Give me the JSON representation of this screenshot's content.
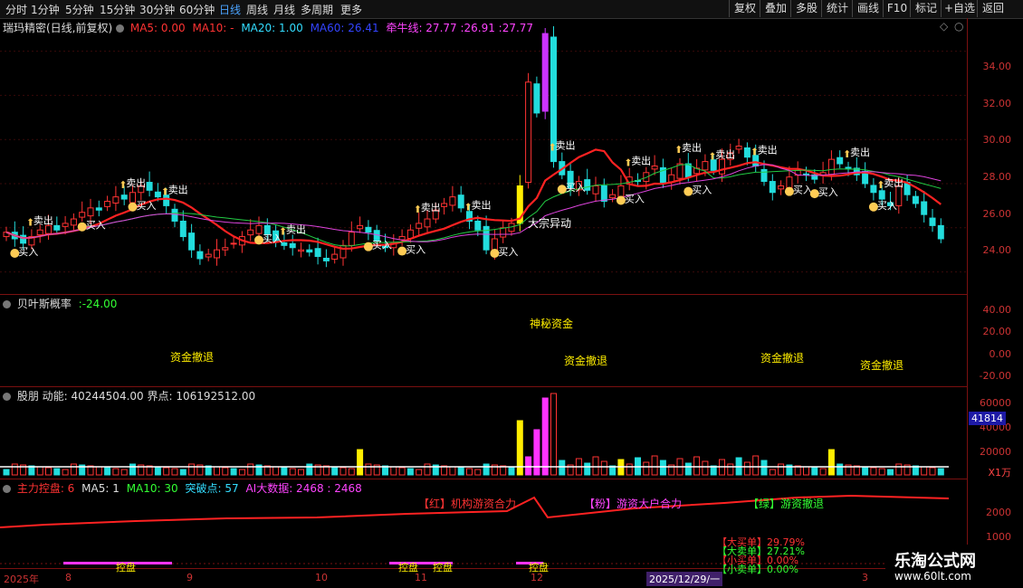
{
  "toolbar": {
    "periods": [
      "分时",
      "1分钟",
      "5分钟",
      "15分钟",
      "30分钟",
      "60分钟",
      "日线",
      "周线",
      "月线",
      "多周期",
      "更多"
    ],
    "active_period": "日线",
    "right_buttons": [
      "复权",
      "叠加",
      "多股",
      "统计",
      "画线",
      "F10",
      "标记",
      "+自选",
      "返回"
    ]
  },
  "main_panel": {
    "stock_title": "瑞玛精密(日线,前复权)",
    "ma5": "MA5: 0.00",
    "ma10": "MA10: -",
    "ma20": "MA20: 1.00",
    "ma60": "MA60: 26.41",
    "qianniu": "牵牛线: 27.77 :26.91 :27.77",
    "colors": {
      "ma5": "#ff3333",
      "ma10": "#ff3333",
      "ma20": "#33ddff",
      "ma60": "#3344ff",
      "qianniu": "#ff44ff"
    },
    "annotations": {
      "buy": "买入",
      "sell": "卖出",
      "block_trade": "大宗异动"
    },
    "price_ticks": [
      "34.00",
      "32.00",
      "30.00",
      "28.00",
      "26.00",
      "24.00"
    ]
  },
  "bayes_panel": {
    "title": "贝叶斯概率",
    "value": ":-24.00",
    "labels": {
      "mystery": "神秘资金",
      "retreat": "资金撤退"
    },
    "ticks": [
      "40.00",
      "20.00",
      "0.00",
      "-20.00"
    ]
  },
  "volume_panel": {
    "title": "股朋 动能: 40244504.00 界点: 106192512.00",
    "ticks": [
      "60000",
      "40000",
      "20000"
    ],
    "badge": "41814",
    "unit": "X1万"
  },
  "control_panel": {
    "title": "主力控盘: 6",
    "ma5": "MA5: 1",
    "ma10": "MA10: 30",
    "breakpoint": "突破点: 57",
    "bigdata": "AI大数据: 2468 : 2468",
    "labels": {
      "red": "【红】机构游资合力",
      "pink": "【粉】游资大户合力",
      "green": "【绿】游资撤退"
    },
    "big_buy": "【大买单】29.79%",
    "big_sell": "【大卖单】27.21%",
    "small_buy": "【小买单】0.00%",
    "small_sell": "【小卖单】0.00%",
    "control_label": "控盘",
    "ticks": [
      "2000",
      "1000"
    ]
  },
  "date_axis": {
    "labels": [
      "2025年",
      "8",
      "9",
      "10",
      "11",
      "12",
      "3"
    ],
    "cursor_date": "2025/12/29/一"
  },
  "watermark": {
    "title": "乐淘公式网",
    "url": "www.60lt.com"
  },
  "chart_data": {
    "type": "candlestick",
    "ylim": [
      23,
      35.5
    ],
    "closes": [
      25.8,
      25.5,
      25.3,
      25.6,
      25.9,
      26.1,
      25.9,
      26.2,
      26.4,
      26.7,
      26.9,
      26.8,
      27.2,
      27.4,
      27.3,
      27.6,
      27.9,
      27.7,
      27.4,
      27.0,
      26.3,
      25.6,
      25.0,
      24.6,
      24.8,
      25.0,
      25.1,
      25.3,
      25.6,
      25.9,
      26.1,
      25.7,
      25.4,
      25.2,
      25.1,
      25.0,
      24.9,
      24.7,
      24.5,
      24.8,
      25.2,
      25.8,
      26.1,
      25.8,
      25.4,
      25.1,
      25.3,
      25.6,
      25.9,
      26.2,
      26.4,
      26.8,
      27.1,
      27.4,
      26.9,
      26.3,
      25.9,
      25.0,
      25.5,
      26.0,
      26.2,
      27.9,
      32.6,
      31.2,
      34.8,
      29.0,
      28.4,
      27.8,
      28.1,
      27.7,
      27.9,
      27.2,
      27.5,
      27.9,
      28.3,
      28.1,
      28.5,
      28.8,
      28.0,
      28.4,
      28.9,
      28.3,
      28.7,
      29.0,
      28.6,
      29.1,
      29.4,
      29.7,
      29.2,
      28.8,
      28.1,
      27.6,
      27.9,
      28.3,
      28.6,
      28.4,
      28.2,
      28.5,
      29.1,
      28.9,
      28.7,
      28.4,
      28.0,
      27.6,
      27.3,
      27.0,
      27.9,
      27.5,
      27.1,
      26.6,
      26.1,
      25.5
    ]
  }
}
